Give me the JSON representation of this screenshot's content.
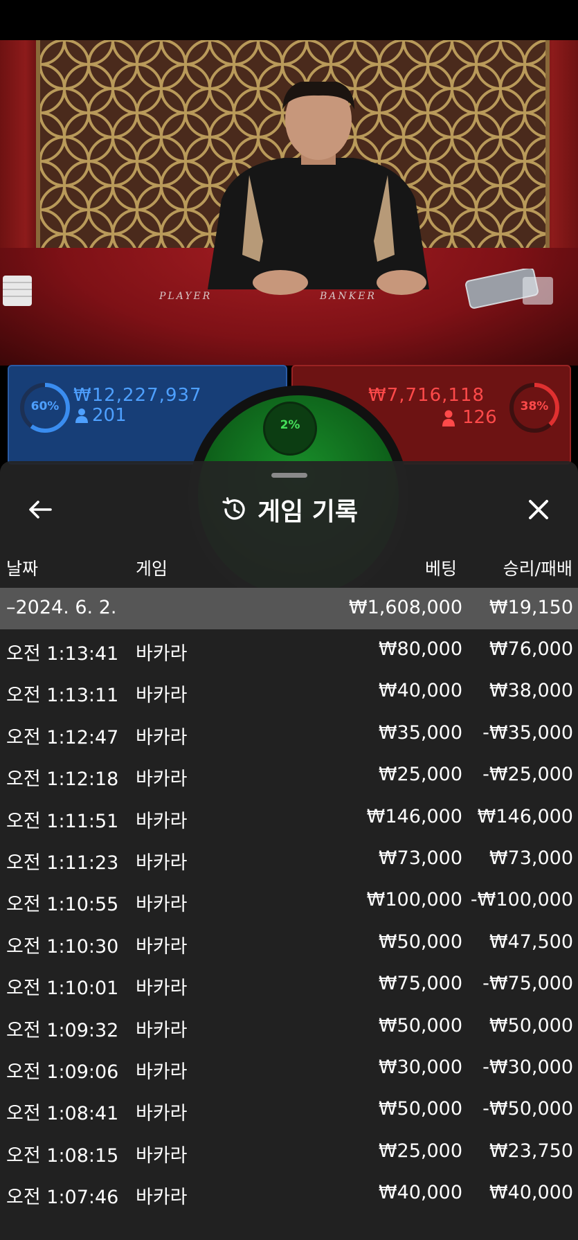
{
  "video": {
    "felt_player_label": "PLAYER",
    "felt_banker_label": "BANKER"
  },
  "bets": {
    "player": {
      "percent_label": "60%",
      "percent": 60,
      "amount": "₩12,227,937",
      "count": "201",
      "color": "#3a8df0"
    },
    "tie": {
      "percent_label": "2%",
      "percent": 2,
      "color": "#46e05a"
    },
    "banker": {
      "percent_label": "38%",
      "percent": 38,
      "amount": "₩7,716,118",
      "count": "126",
      "color": "#e03030"
    }
  },
  "sheet": {
    "title": "게임 기록",
    "icons": {
      "back": "arrow-left-icon",
      "history": "history-icon",
      "close": "close-icon"
    },
    "columns": {
      "date": "날짜",
      "game": "게임",
      "bet": "베팅",
      "result": "승리/패배"
    },
    "summary": {
      "date": "–2024. 6. 2.",
      "bet": "₩1,608,000",
      "result": "₩19,150"
    },
    "rows": [
      {
        "time": "오전 1:13:41",
        "game": "바카라",
        "bet": "₩80,000",
        "result": "₩76,000"
      },
      {
        "time": "오전 1:13:11",
        "game": "바카라",
        "bet": "₩40,000",
        "result": "₩38,000"
      },
      {
        "time": "오전 1:12:47",
        "game": "바카라",
        "bet": "₩35,000",
        "result": "-₩35,000"
      },
      {
        "time": "오전 1:12:18",
        "game": "바카라",
        "bet": "₩25,000",
        "result": "-₩25,000"
      },
      {
        "time": "오전 1:11:51",
        "game": "바카라",
        "bet": "₩146,000",
        "result": "₩146,000"
      },
      {
        "time": "오전 1:11:23",
        "game": "바카라",
        "bet": "₩73,000",
        "result": "₩73,000"
      },
      {
        "time": "오전 1:10:55",
        "game": "바카라",
        "bet": "₩100,000",
        "result": "-₩100,000"
      },
      {
        "time": "오전 1:10:30",
        "game": "바카라",
        "bet": "₩50,000",
        "result": "₩47,500"
      },
      {
        "time": "오전 1:10:01",
        "game": "바카라",
        "bet": "₩75,000",
        "result": "-₩75,000"
      },
      {
        "time": "오전 1:09:32",
        "game": "바카라",
        "bet": "₩50,000",
        "result": "₩50,000"
      },
      {
        "time": "오전 1:09:06",
        "game": "바카라",
        "bet": "₩30,000",
        "result": "-₩30,000"
      },
      {
        "time": "오전 1:08:41",
        "game": "바카라",
        "bet": "₩50,000",
        "result": "-₩50,000"
      },
      {
        "time": "오전 1:08:15",
        "game": "바카라",
        "bet": "₩25,000",
        "result": "₩23,750"
      },
      {
        "time": "오전 1:07:46",
        "game": "바카라",
        "bet": "₩40,000",
        "result": "₩40,000"
      }
    ]
  }
}
